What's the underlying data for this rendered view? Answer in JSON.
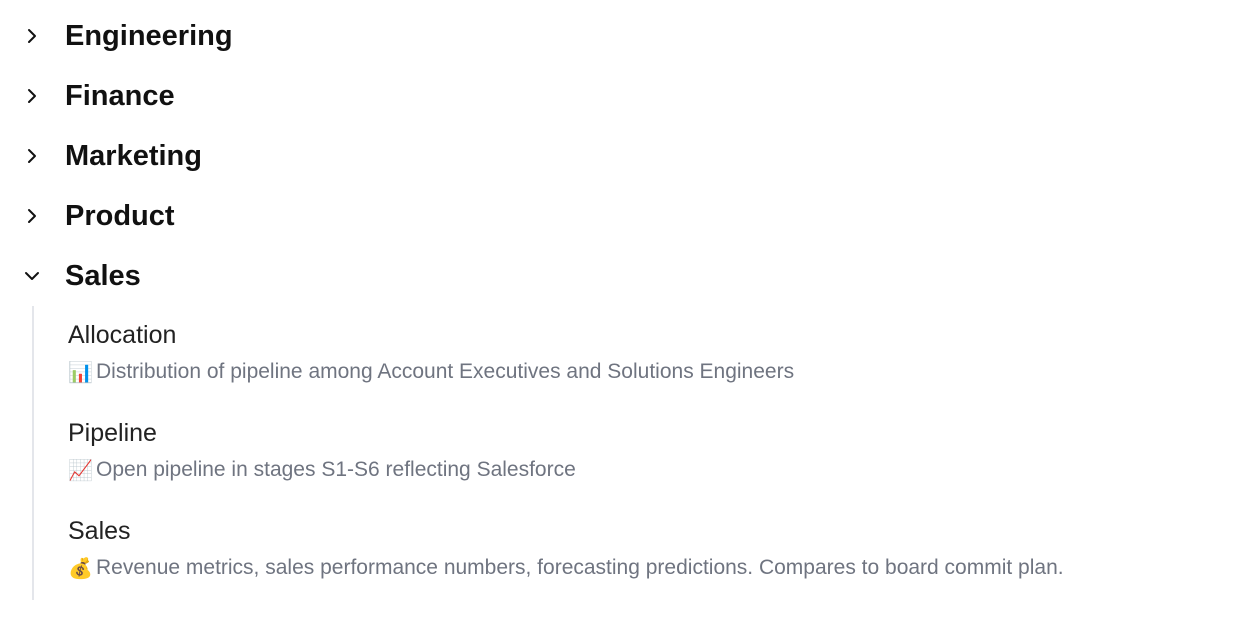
{
  "groups": [
    {
      "title": "Engineering",
      "expanded": false
    },
    {
      "title": "Finance",
      "expanded": false
    },
    {
      "title": "Marketing",
      "expanded": false
    },
    {
      "title": "Product",
      "expanded": false
    },
    {
      "title": "Sales",
      "expanded": true,
      "items": [
        {
          "title": "Allocation",
          "icon": "📊",
          "description": "Distribution of pipeline among Account Executives and Solutions Engineers"
        },
        {
          "title": "Pipeline",
          "icon": "📈",
          "description": "Open pipeline in stages S1-S6 reflecting Salesforce"
        },
        {
          "title": "Sales",
          "icon": "💰",
          "description": "Revenue metrics, sales performance numbers, forecasting predictions. Compares to board commit plan."
        }
      ]
    }
  ]
}
